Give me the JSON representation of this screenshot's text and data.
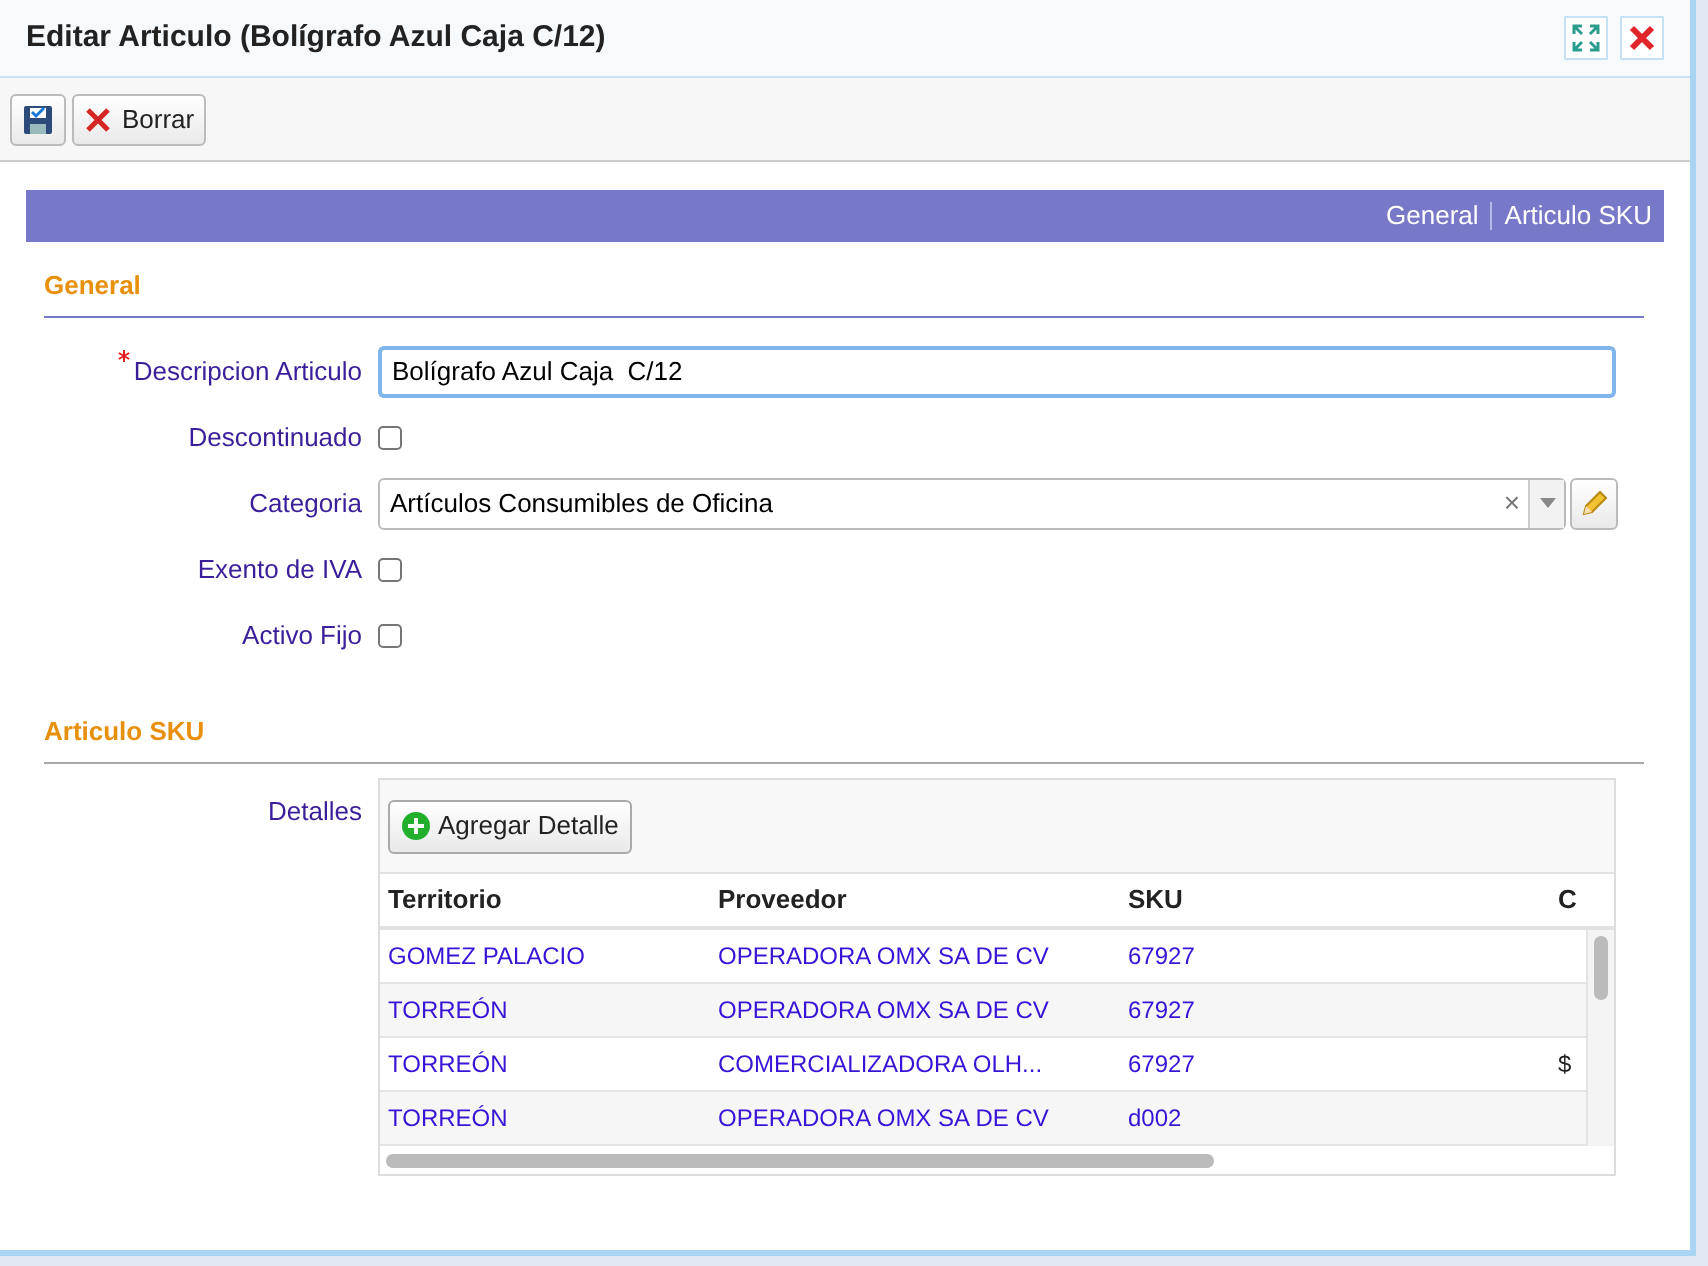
{
  "window": {
    "title": "Editar Articulo (Bolígrafo Azul Caja C/12)"
  },
  "toolbar": {
    "buttons": [
      {
        "kind": "save"
      },
      {
        "kind": "delete",
        "label": "Borrar"
      }
    ]
  },
  "section_nav": [
    "General",
    "Articulo SKU"
  ],
  "sections": [
    {
      "title": "General",
      "fields": [
        {
          "kind": "text",
          "label": "Descripcion Articulo",
          "required": true,
          "value": "Bolígrafo Azul Caja  C/12"
        },
        {
          "kind": "checkbox",
          "label": "Descontinuado",
          "required": false,
          "checked": false
        },
        {
          "kind": "combo",
          "label": "Categoria",
          "required": false,
          "value": "Artículos Consumibles de Oficina",
          "clear": "×"
        },
        {
          "kind": "checkbox",
          "label": "Exento de IVA",
          "required": false,
          "checked": false
        },
        {
          "kind": "checkbox",
          "label": "Activo Fijo",
          "required": false,
          "checked": false
        }
      ]
    },
    {
      "title": "Articulo SKU",
      "fields": [
        {
          "kind": "grid",
          "label": "Detalles",
          "required": false,
          "add_button": "Agregar Detalle",
          "columns": [
            "Territorio",
            "Proveedor",
            "SKU",
            "C"
          ],
          "rows": [
            [
              "GOMEZ PALACIO",
              "OPERADORA OMX SA DE CV",
              "67927",
              ""
            ],
            [
              "TORREÓN",
              "OPERADORA OMX SA DE CV",
              "67927",
              ""
            ],
            [
              "TORREÓN",
              "COMERCIALIZADORA OLH...",
              "67927",
              "$"
            ],
            [
              "TORREÓN",
              "OPERADORA OMX SA DE CV",
              "d002",
              ""
            ]
          ]
        }
      ]
    }
  ]
}
